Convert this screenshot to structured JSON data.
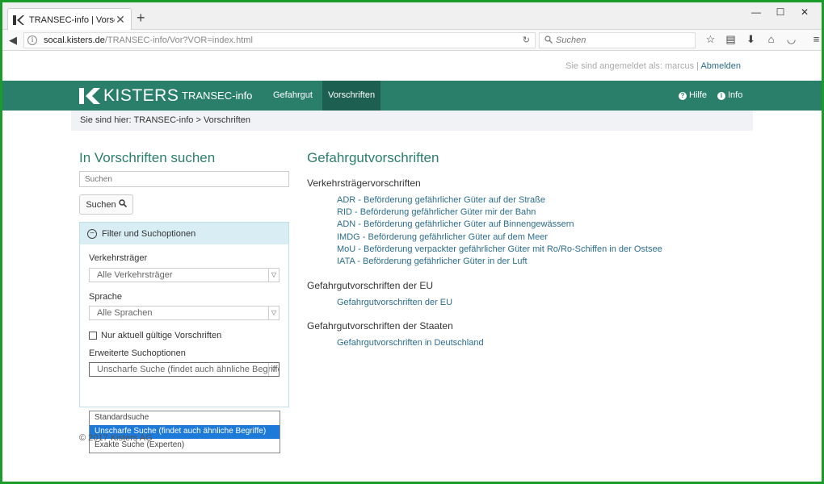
{
  "browser": {
    "tab_title": "TRANSEC-info | Vorschrift",
    "tab_close": "✕",
    "new_tab": "+",
    "url_domain": "socal.kisters.de",
    "url_rest": "/TRANSEC-info/Vor?VOR=index.html",
    "search_placeholder": "Suchen",
    "window_controls": [
      "—",
      "☐",
      "✕"
    ]
  },
  "header": {
    "user_label": "Sie sind angemeldet als: marcus |",
    "logout_label": "Abmelden",
    "logo_text": "KISTERS",
    "app_name": "TRANSEC-info",
    "nav": [
      "Gefahrgut",
      "Vorschriften"
    ],
    "help_label": "Hilfe",
    "info_label": "Info",
    "colors": {
      "brand": "#2a7f6b",
      "active_nav": "#1d5f50"
    }
  },
  "breadcrumb": {
    "text": "Sie sind hier: TRANSEC-info > Vorschriften"
  },
  "sidebar": {
    "title": "In Vorschriften suchen",
    "search_placeholder": "Suchen",
    "search_button": "Suchen",
    "filter_title": "Filter und Suchoptionen",
    "carrier_label": "Verkehrsträger",
    "carrier_value": "Alle Verkehrsträger",
    "language_label": "Sprache",
    "language_value": "Alle Sprachen",
    "checkbox_label": "Nur aktuell gültige Vorschriften",
    "advanced_label": "Erweiterte Suchoptionen",
    "advanced_value": "Unscharfe Suche (findet auch ähnliche Begriffe)",
    "advanced_options": [
      "Standardsuche",
      "Unscharfe Suche (findet auch ähnliche Begriffe)",
      "Exakte Suche (Experten)"
    ]
  },
  "footer": {
    "text": "© 2017 Kisters AG"
  },
  "main": {
    "title": "Gefahrgutvorschriften",
    "sections": [
      {
        "heading": "Verkehrsträgervorschriften",
        "links": [
          "ADR - Beförderung gefährlicher Güter auf der Straße",
          "RID - Beförderung gefährlicher Güter mir der Bahn",
          "ADN - Beförderung gefährlicher Güter auf Binnengewässern",
          "IMDG - Beförderung gefährlicher Güter auf dem Meer",
          "MoU - Beförderung verpackter gefährlicher Güter mit Ro/Ro-Schiffen in der Ostsee",
          "IATA - Beförderung gefährlicher Güter in der Luft"
        ]
      },
      {
        "heading": "Gefahrgutvorschriften der EU",
        "links": [
          "Gefahrgutvorschriften der EU"
        ]
      },
      {
        "heading": "Gefahrgutvorschriften der Staaten",
        "links": [
          "Gefahrgutvorschriften in Deutschland"
        ]
      }
    ]
  }
}
